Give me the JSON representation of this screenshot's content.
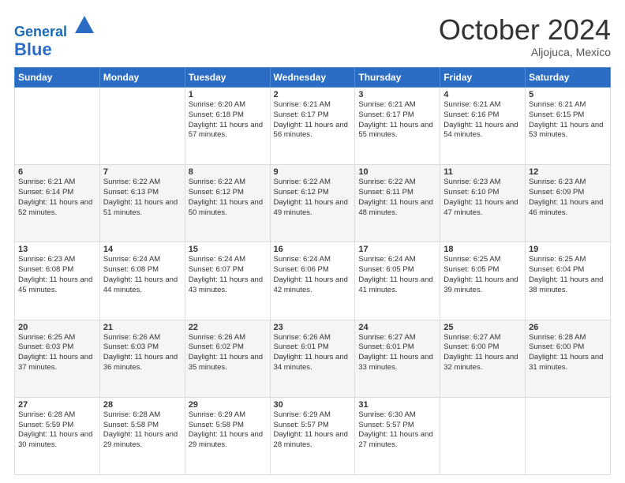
{
  "header": {
    "logo_line1": "General",
    "logo_line2": "Blue",
    "month": "October 2024",
    "location": "Aljojuca, Mexico"
  },
  "days_of_week": [
    "Sunday",
    "Monday",
    "Tuesday",
    "Wednesday",
    "Thursday",
    "Friday",
    "Saturday"
  ],
  "weeks": [
    [
      {
        "day": "",
        "sunrise": "",
        "sunset": "",
        "daylight": ""
      },
      {
        "day": "",
        "sunrise": "",
        "sunset": "",
        "daylight": ""
      },
      {
        "day": "1",
        "sunrise": "Sunrise: 6:20 AM",
        "sunset": "Sunset: 6:18 PM",
        "daylight": "Daylight: 11 hours and 57 minutes."
      },
      {
        "day": "2",
        "sunrise": "Sunrise: 6:21 AM",
        "sunset": "Sunset: 6:17 PM",
        "daylight": "Daylight: 11 hours and 56 minutes."
      },
      {
        "day": "3",
        "sunrise": "Sunrise: 6:21 AM",
        "sunset": "Sunset: 6:17 PM",
        "daylight": "Daylight: 11 hours and 55 minutes."
      },
      {
        "day": "4",
        "sunrise": "Sunrise: 6:21 AM",
        "sunset": "Sunset: 6:16 PM",
        "daylight": "Daylight: 11 hours and 54 minutes."
      },
      {
        "day": "5",
        "sunrise": "Sunrise: 6:21 AM",
        "sunset": "Sunset: 6:15 PM",
        "daylight": "Daylight: 11 hours and 53 minutes."
      }
    ],
    [
      {
        "day": "6",
        "sunrise": "Sunrise: 6:21 AM",
        "sunset": "Sunset: 6:14 PM",
        "daylight": "Daylight: 11 hours and 52 minutes."
      },
      {
        "day": "7",
        "sunrise": "Sunrise: 6:22 AM",
        "sunset": "Sunset: 6:13 PM",
        "daylight": "Daylight: 11 hours and 51 minutes."
      },
      {
        "day": "8",
        "sunrise": "Sunrise: 6:22 AM",
        "sunset": "Sunset: 6:12 PM",
        "daylight": "Daylight: 11 hours and 50 minutes."
      },
      {
        "day": "9",
        "sunrise": "Sunrise: 6:22 AM",
        "sunset": "Sunset: 6:12 PM",
        "daylight": "Daylight: 11 hours and 49 minutes."
      },
      {
        "day": "10",
        "sunrise": "Sunrise: 6:22 AM",
        "sunset": "Sunset: 6:11 PM",
        "daylight": "Daylight: 11 hours and 48 minutes."
      },
      {
        "day": "11",
        "sunrise": "Sunrise: 6:23 AM",
        "sunset": "Sunset: 6:10 PM",
        "daylight": "Daylight: 11 hours and 47 minutes."
      },
      {
        "day": "12",
        "sunrise": "Sunrise: 6:23 AM",
        "sunset": "Sunset: 6:09 PM",
        "daylight": "Daylight: 11 hours and 46 minutes."
      }
    ],
    [
      {
        "day": "13",
        "sunrise": "Sunrise: 6:23 AM",
        "sunset": "Sunset: 6:08 PM",
        "daylight": "Daylight: 11 hours and 45 minutes."
      },
      {
        "day": "14",
        "sunrise": "Sunrise: 6:24 AM",
        "sunset": "Sunset: 6:08 PM",
        "daylight": "Daylight: 11 hours and 44 minutes."
      },
      {
        "day": "15",
        "sunrise": "Sunrise: 6:24 AM",
        "sunset": "Sunset: 6:07 PM",
        "daylight": "Daylight: 11 hours and 43 minutes."
      },
      {
        "day": "16",
        "sunrise": "Sunrise: 6:24 AM",
        "sunset": "Sunset: 6:06 PM",
        "daylight": "Daylight: 11 hours and 42 minutes."
      },
      {
        "day": "17",
        "sunrise": "Sunrise: 6:24 AM",
        "sunset": "Sunset: 6:05 PM",
        "daylight": "Daylight: 11 hours and 41 minutes."
      },
      {
        "day": "18",
        "sunrise": "Sunrise: 6:25 AM",
        "sunset": "Sunset: 6:05 PM",
        "daylight": "Daylight: 11 hours and 39 minutes."
      },
      {
        "day": "19",
        "sunrise": "Sunrise: 6:25 AM",
        "sunset": "Sunset: 6:04 PM",
        "daylight": "Daylight: 11 hours and 38 minutes."
      }
    ],
    [
      {
        "day": "20",
        "sunrise": "Sunrise: 6:25 AM",
        "sunset": "Sunset: 6:03 PM",
        "daylight": "Daylight: 11 hours and 37 minutes."
      },
      {
        "day": "21",
        "sunrise": "Sunrise: 6:26 AM",
        "sunset": "Sunset: 6:03 PM",
        "daylight": "Daylight: 11 hours and 36 minutes."
      },
      {
        "day": "22",
        "sunrise": "Sunrise: 6:26 AM",
        "sunset": "Sunset: 6:02 PM",
        "daylight": "Daylight: 11 hours and 35 minutes."
      },
      {
        "day": "23",
        "sunrise": "Sunrise: 6:26 AM",
        "sunset": "Sunset: 6:01 PM",
        "daylight": "Daylight: 11 hours and 34 minutes."
      },
      {
        "day": "24",
        "sunrise": "Sunrise: 6:27 AM",
        "sunset": "Sunset: 6:01 PM",
        "daylight": "Daylight: 11 hours and 33 minutes."
      },
      {
        "day": "25",
        "sunrise": "Sunrise: 6:27 AM",
        "sunset": "Sunset: 6:00 PM",
        "daylight": "Daylight: 11 hours and 32 minutes."
      },
      {
        "day": "26",
        "sunrise": "Sunrise: 6:28 AM",
        "sunset": "Sunset: 6:00 PM",
        "daylight": "Daylight: 11 hours and 31 minutes."
      }
    ],
    [
      {
        "day": "27",
        "sunrise": "Sunrise: 6:28 AM",
        "sunset": "Sunset: 5:59 PM",
        "daylight": "Daylight: 11 hours and 30 minutes."
      },
      {
        "day": "28",
        "sunrise": "Sunrise: 6:28 AM",
        "sunset": "Sunset: 5:58 PM",
        "daylight": "Daylight: 11 hours and 29 minutes."
      },
      {
        "day": "29",
        "sunrise": "Sunrise: 6:29 AM",
        "sunset": "Sunset: 5:58 PM",
        "daylight": "Daylight: 11 hours and 29 minutes."
      },
      {
        "day": "30",
        "sunrise": "Sunrise: 6:29 AM",
        "sunset": "Sunset: 5:57 PM",
        "daylight": "Daylight: 11 hours and 28 minutes."
      },
      {
        "day": "31",
        "sunrise": "Sunrise: 6:30 AM",
        "sunset": "Sunset: 5:57 PM",
        "daylight": "Daylight: 11 hours and 27 minutes."
      },
      {
        "day": "",
        "sunrise": "",
        "sunset": "",
        "daylight": ""
      },
      {
        "day": "",
        "sunrise": "",
        "sunset": "",
        "daylight": ""
      }
    ]
  ]
}
